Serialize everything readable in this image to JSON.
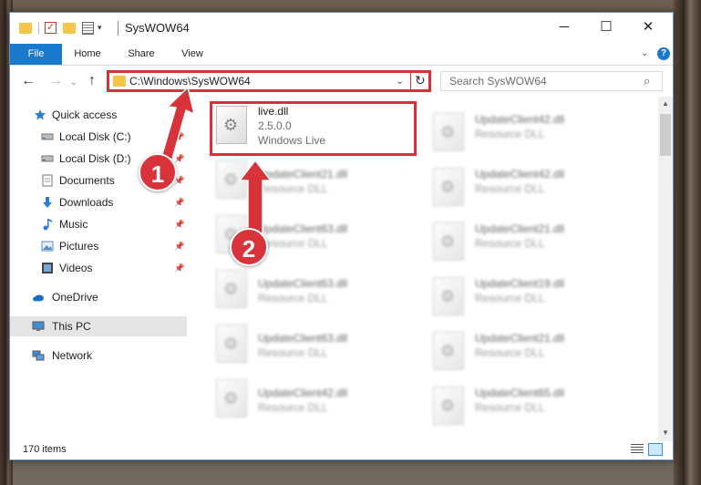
{
  "window": {
    "title": "SysWOW64",
    "controls": {
      "minimize": "─",
      "maximize": "☐",
      "close": "✕"
    }
  },
  "quick_access_toolbar": {
    "check_glyph": "✓",
    "dropdown_glyph": "▾"
  },
  "ribbon": {
    "tabs": [
      "File",
      "Home",
      "Share",
      "View"
    ],
    "expand_glyph": "⌄",
    "help_glyph": "?"
  },
  "navigation": {
    "back_glyph": "←",
    "forward_glyph": "→",
    "recent_glyph": "⌄",
    "up_glyph": "↑",
    "address": "C:\\Windows\\SysWOW64",
    "address_dropdown_glyph": "⌄",
    "refresh_glyph": "↻",
    "search_placeholder": "Search SysWOW64",
    "search_glyph": "⌕"
  },
  "sidebar": {
    "items": [
      {
        "label": "Quick access",
        "icon": "star-icon",
        "pinned": false
      },
      {
        "label": "Local Disk (C:)",
        "icon": "drive-icon",
        "pinned": true
      },
      {
        "label": "Local Disk (D:)",
        "icon": "drive-icon",
        "pinned": true
      },
      {
        "label": "Documents",
        "icon": "document-icon",
        "pinned": true
      },
      {
        "label": "Downloads",
        "icon": "download-icon",
        "pinned": true
      },
      {
        "label": "Music",
        "icon": "music-icon",
        "pinned": true
      },
      {
        "label": "Pictures",
        "icon": "pictures-icon",
        "pinned": true
      },
      {
        "label": "Videos",
        "icon": "video-icon",
        "pinned": true
      },
      {
        "label": "OneDrive",
        "icon": "cloud-icon",
        "pinned": false
      },
      {
        "label": "This PC",
        "icon": "computer-icon",
        "pinned": false
      },
      {
        "label": "Network",
        "icon": "network-icon",
        "pinned": false
      }
    ],
    "pin_glyph": "📌"
  },
  "files": [
    {
      "name": "live.dll",
      "line2": "2.5.0.0",
      "line3": "Windows Live"
    },
    {
      "name": "UpdateClient42.dll",
      "line2": "Resource DLL"
    },
    {
      "name": "UpdateClient21.dll",
      "line2": "Resource DLL"
    },
    {
      "name": "UpdateClient42.dll",
      "line2": "Resource DLL"
    },
    {
      "name": "UpdateClient63.dll",
      "line2": "Resource DLL"
    },
    {
      "name": "UpdateClient21.dll",
      "line2": "Resource DLL"
    },
    {
      "name": "UpdateClient63.dll",
      "line2": "Resource DLL"
    },
    {
      "name": "UpdateClient19.dll",
      "line2": "Resource DLL"
    },
    {
      "name": "UpdateClient63.dll",
      "line2": "Resource DLL"
    },
    {
      "name": "UpdateClient21.dll",
      "line2": "Resource DLL"
    },
    {
      "name": "UpdateClient42.dll",
      "line2": "Resource DLL"
    },
    {
      "name": "UpdateClient65.dll",
      "line2": "Resource DLL"
    }
  ],
  "status": {
    "item_count": "170 items"
  },
  "annotations": {
    "step1": "1",
    "step2": "2",
    "color": "#d8323a"
  },
  "scrollbar": {
    "up_glyph": "▲",
    "down_glyph": "▼"
  }
}
